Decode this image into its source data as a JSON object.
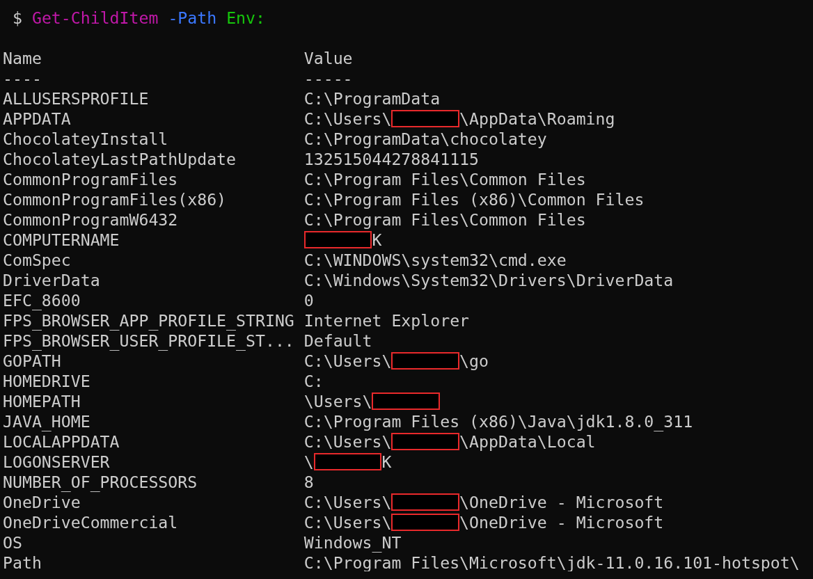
{
  "prompt": {
    "symbol": "$",
    "parts": [
      {
        "kind": "command",
        "text": "Get-ChildItem"
      },
      {
        "kind": "parameter",
        "text": "-Path"
      },
      {
        "kind": "argument",
        "text": "Env:"
      }
    ]
  },
  "columns": [
    {
      "heading": "Name",
      "rule": "----"
    },
    {
      "heading": "Value",
      "rule": "-----"
    }
  ],
  "rows": [
    {
      "name": "ALLUSERSPROFILE",
      "value": [
        {
          "kind": "text",
          "text": "C:\\ProgramData"
        }
      ]
    },
    {
      "name": "APPDATA",
      "value": [
        {
          "kind": "text",
          "text": "C:\\Users\\"
        },
        {
          "kind": "redacted"
        },
        {
          "kind": "text",
          "text": "\\AppData\\Roaming"
        }
      ]
    },
    {
      "name": "ChocolateyInstall",
      "value": [
        {
          "kind": "text",
          "text": "C:\\ProgramData\\chocolatey"
        }
      ]
    },
    {
      "name": "ChocolateyLastPathUpdate",
      "value": [
        {
          "kind": "text",
          "text": "132515044278841115"
        }
      ]
    },
    {
      "name": "CommonProgramFiles",
      "value": [
        {
          "kind": "text",
          "text": "C:\\Program Files\\Common Files"
        }
      ]
    },
    {
      "name": "CommonProgramFiles(x86)",
      "value": [
        {
          "kind": "text",
          "text": "C:\\Program Files (x86)\\Common Files"
        }
      ]
    },
    {
      "name": "CommonProgramW6432",
      "value": [
        {
          "kind": "text",
          "text": "C:\\Program Files\\Common Files"
        }
      ]
    },
    {
      "name": "COMPUTERNAME",
      "value": [
        {
          "kind": "redacted"
        },
        {
          "kind": "text",
          "text": "K"
        }
      ]
    },
    {
      "name": "ComSpec",
      "value": [
        {
          "kind": "text",
          "text": "C:\\WINDOWS\\system32\\cmd.exe"
        }
      ]
    },
    {
      "name": "DriverData",
      "value": [
        {
          "kind": "text",
          "text": "C:\\Windows\\System32\\Drivers\\DriverData"
        }
      ]
    },
    {
      "name": "EFC_8600",
      "value": [
        {
          "kind": "text",
          "text": "0"
        }
      ]
    },
    {
      "name": "FPS_BROWSER_APP_PROFILE_STRING",
      "value": [
        {
          "kind": "text",
          "text": "Internet Explorer"
        }
      ]
    },
    {
      "name": "FPS_BROWSER_USER_PROFILE_ST...",
      "value": [
        {
          "kind": "text",
          "text": "Default"
        }
      ]
    },
    {
      "name": "GOPATH",
      "value": [
        {
          "kind": "text",
          "text": "C:\\Users\\"
        },
        {
          "kind": "redacted"
        },
        {
          "kind": "text",
          "text": "\\go"
        }
      ]
    },
    {
      "name": "HOMEDRIVE",
      "value": [
        {
          "kind": "text",
          "text": "C:"
        }
      ]
    },
    {
      "name": "HOMEPATH",
      "value": [
        {
          "kind": "text",
          "text": "\\Users\\"
        },
        {
          "kind": "redacted"
        }
      ]
    },
    {
      "name": "JAVA_HOME",
      "value": [
        {
          "kind": "text",
          "text": "C:\\Program Files (x86)\\Java\\jdk1.8.0_311"
        }
      ]
    },
    {
      "name": "LOCALAPPDATA",
      "value": [
        {
          "kind": "text",
          "text": "C:\\Users\\"
        },
        {
          "kind": "redacted"
        },
        {
          "kind": "text",
          "text": "\\AppData\\Local"
        }
      ]
    },
    {
      "name": "LOGONSERVER",
      "value": [
        {
          "kind": "text",
          "text": "\\"
        },
        {
          "kind": "redacted"
        },
        {
          "kind": "text",
          "text": "K"
        }
      ]
    },
    {
      "name": "NUMBER_OF_PROCESSORS",
      "value": [
        {
          "kind": "text",
          "text": "8"
        }
      ]
    },
    {
      "name": "OneDrive",
      "value": [
        {
          "kind": "text",
          "text": "C:\\Users\\"
        },
        {
          "kind": "redacted"
        },
        {
          "kind": "text",
          "text": "\\OneDrive - Microsoft"
        }
      ]
    },
    {
      "name": "OneDriveCommercial",
      "value": [
        {
          "kind": "text",
          "text": "C:\\Users\\"
        },
        {
          "kind": "redacted"
        },
        {
          "kind": "text",
          "text": "\\OneDrive - Microsoft"
        }
      ]
    },
    {
      "name": "OS",
      "value": [
        {
          "kind": "text",
          "text": "Windows_NT"
        }
      ]
    },
    {
      "name": "Path",
      "value": [
        {
          "kind": "text",
          "text": "C:\\Program Files\\Microsoft\\jdk-11.0.16.101-hotspot\\"
        }
      ]
    }
  ]
}
